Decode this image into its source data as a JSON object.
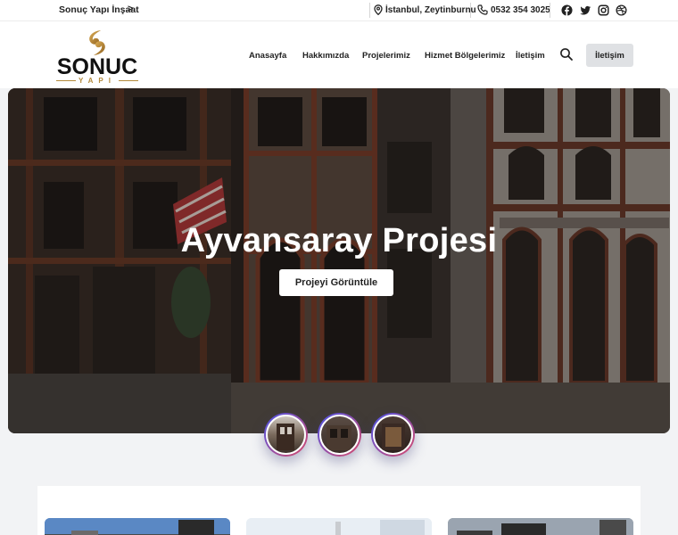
{
  "topbar": {
    "brand": "Sonuç Yapı İnşaat",
    "brand_arrow": ">",
    "location": "İstanbul, Zeytinburnu",
    "phone": "0532 354 3025",
    "social_icons": [
      "facebook-icon",
      "twitter-icon",
      "instagram-icon",
      "dribbble-icon"
    ]
  },
  "logo": {
    "name": "SONUC",
    "sub": "YAPI"
  },
  "nav": {
    "items": [
      "Anasayfa",
      "Hakkımızda",
      "Projelerimiz",
      "Hizmet Bölgelerimiz",
      "İletişim"
    ],
    "contact_button": "İletişim"
  },
  "hero": {
    "title": "Ayvansaray Projesi",
    "button": "Projeyi Görüntüle"
  },
  "colors": {
    "accent_gold": "#b48a3c",
    "thumb_gradient_start": "#4a54e8",
    "thumb_gradient_end": "#d84a6a"
  }
}
